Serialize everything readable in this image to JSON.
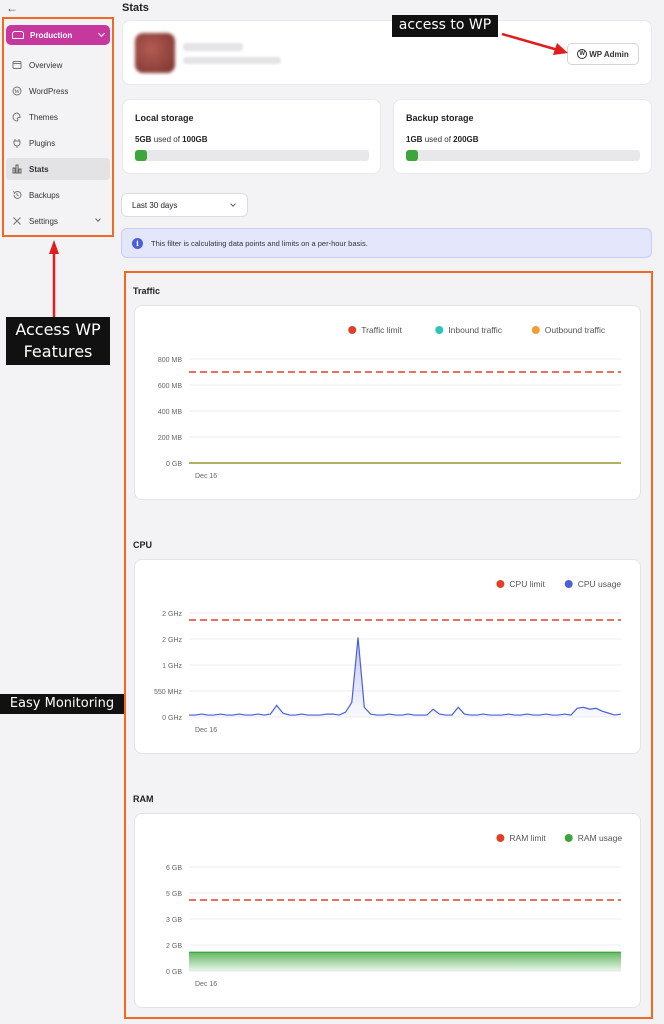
{
  "sidebar": {
    "environment": "Production",
    "items": [
      {
        "label": "Overview",
        "icon": "window-icon"
      },
      {
        "label": "WordPress",
        "icon": "wordpress-icon"
      },
      {
        "label": "Themes",
        "icon": "palette-icon"
      },
      {
        "label": "Plugins",
        "icon": "plug-icon"
      },
      {
        "label": "Stats",
        "icon": "bar-chart-icon",
        "active": true
      },
      {
        "label": "Backups",
        "icon": "history-icon"
      },
      {
        "label": "Settings",
        "icon": "tools-icon"
      }
    ]
  },
  "callouts": {
    "features": "Access WP Features",
    "wp": "access to WP",
    "monitoring": "Easy Monitoring"
  },
  "page": {
    "title": "Stats",
    "wp_admin_label": "WP Admin"
  },
  "storage": {
    "local": {
      "title": "Local storage",
      "used": "5GB",
      "of": "used of",
      "total": "100GB",
      "fraction": 0.05
    },
    "backup": {
      "title": "Backup storage",
      "used": "1GB",
      "of": "used of",
      "total": "200GB",
      "fraction": 0.05
    }
  },
  "filter": {
    "range": "Last 30 days",
    "info": "This filter is calculating data points and limits on a per-hour basis."
  },
  "colors": {
    "accent": "#c7389e",
    "highlight": "#f26a21",
    "limit": "#e0402a",
    "inbound": "#2ec4b6",
    "outbound": "#f0a030",
    "cpu": "#4b5fd6",
    "ram": "#3ca63c"
  },
  "chart_data": [
    {
      "type": "line",
      "title": "Traffic",
      "x_tick": "Dec 16",
      "y_ticks": [
        "800 MB",
        "600 MB",
        "400 MB",
        "200 MB",
        "0 GB"
      ],
      "ylim": [
        0,
        800
      ],
      "legend": [
        "Traffic limit",
        "Inbound traffic",
        "Outbound traffic"
      ],
      "limit": 700,
      "series": [
        {
          "name": "Inbound traffic",
          "values": [
            0,
            0,
            0,
            0,
            0,
            0
          ]
        },
        {
          "name": "Outbound traffic",
          "values": [
            0,
            0,
            0,
            0,
            0,
            0
          ]
        }
      ]
    },
    {
      "type": "area",
      "title": "CPU",
      "x_tick": "Dec 16",
      "y_ticks": [
        "2 GHz",
        "2 GHz",
        "1 GHz",
        "550 MHz",
        "0 GHz"
      ],
      "legend": [
        "CPU limit",
        "CPU usage"
      ],
      "series": [
        {
          "name": "CPU usage",
          "values": [
            0.02,
            0.02,
            0.03,
            0.02,
            0.02,
            0.03,
            0.02,
            0.02,
            0.03,
            0.02,
            0.02,
            0.03,
            0.02,
            0.03,
            0.12,
            0.04,
            0.02,
            0.02,
            0.03,
            0.02,
            0.02,
            0.02,
            0.03,
            0.03,
            0.02,
            0.05,
            0.15,
            0.82,
            0.1,
            0.03,
            0.02,
            0.02,
            0.03,
            0.02,
            0.02,
            0.03,
            0.02,
            0.02,
            0.02,
            0.08,
            0.03,
            0.02,
            0.02,
            0.1,
            0.03,
            0.02,
            0.02,
            0.03,
            0.02,
            0.02,
            0.02,
            0.03,
            0.02,
            0.02,
            0.03,
            0.02,
            0.02,
            0.03,
            0.02,
            0.02,
            0.03,
            0.02,
            0.09,
            0.1,
            0.08,
            0.09,
            0.06,
            0.04,
            0.02,
            0.03
          ]
        }
      ]
    },
    {
      "type": "area",
      "title": "RAM",
      "x_tick": "Dec 16",
      "y_ticks": [
        "6 GB",
        "5 GB",
        "3 GB",
        "2 GB",
        "0 GB"
      ],
      "legend": [
        "RAM limit",
        "RAM usage"
      ],
      "series": [
        {
          "name": "RAM usage",
          "values": [
            1.5,
            1.5,
            1.5,
            1.5,
            1.5,
            1.5,
            1.5,
            1.5,
            1.5,
            1.5
          ]
        }
      ]
    }
  ]
}
